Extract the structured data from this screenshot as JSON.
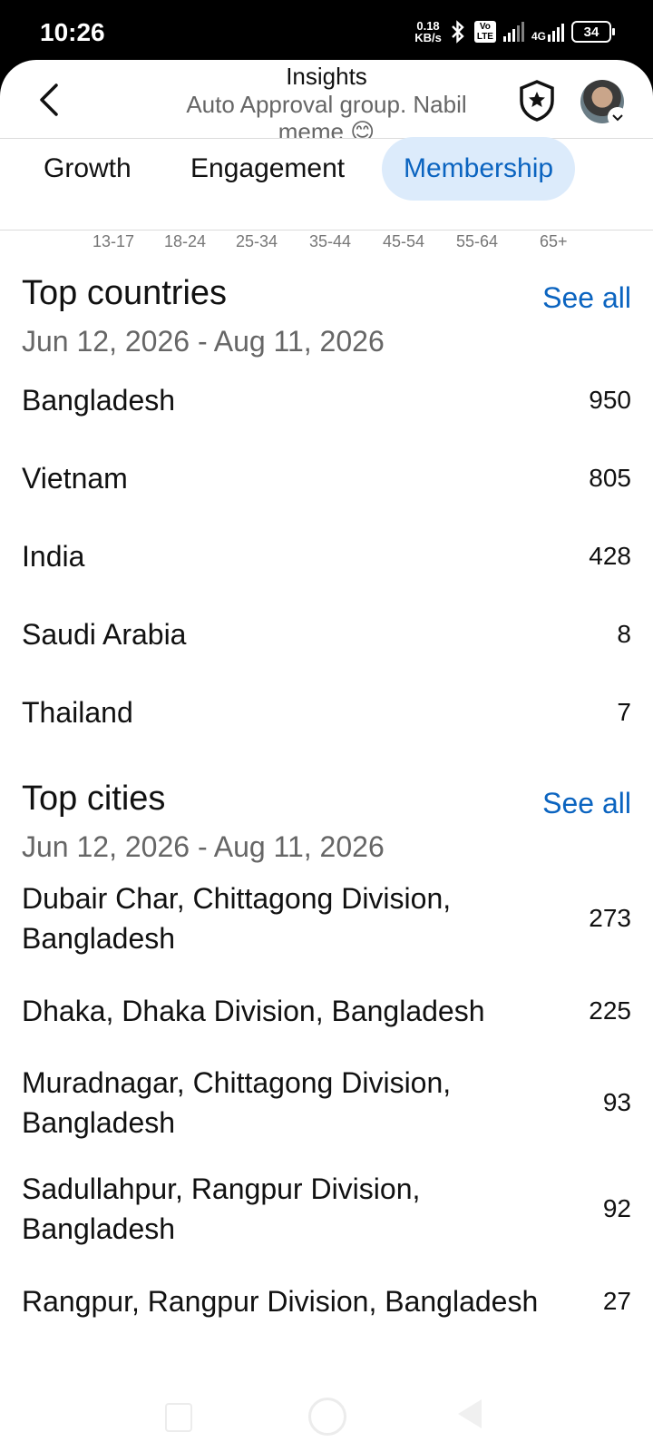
{
  "status_bar": {
    "time": "10:26",
    "net_speed_value": "0.18",
    "net_speed_unit": "KB/s",
    "volte_top": "Vo",
    "volte_bottom": "LTE",
    "network_type": "4G",
    "battery": "34"
  },
  "header": {
    "title": "Insights",
    "subtitle": "Auto Approval group. Nabil",
    "subtitle_cut": "meme 😊"
  },
  "tabs": [
    {
      "label": "Growth",
      "active": false
    },
    {
      "label": "Engagement",
      "active": false
    },
    {
      "label": "Membership",
      "active": true
    }
  ],
  "age_ranges": [
    "13-17",
    "18-24",
    "25-34",
    "35-44",
    "45-54",
    "55-64",
    "65+"
  ],
  "top_countries": {
    "title": "Top countries",
    "see_all": "See all",
    "date_range": "Jun 12, 2026 - Aug 11, 2026",
    "rows": [
      {
        "label": "Bangladesh",
        "value": "950"
      },
      {
        "label": "Vietnam",
        "value": "805"
      },
      {
        "label": "India",
        "value": "428"
      },
      {
        "label": "Saudi Arabia",
        "value": "8"
      },
      {
        "label": "Thailand",
        "value": "7"
      }
    ]
  },
  "top_cities": {
    "title": "Top cities",
    "see_all": "See all",
    "date_range": "Jun 12, 2026 - Aug 11, 2026",
    "rows": [
      {
        "label": "Dubair Char, Chittagong Division, Bangladesh",
        "value": "273"
      },
      {
        "label": "Dhaka, Dhaka Division, Bangladesh",
        "value": "225"
      },
      {
        "label": "Muradnagar, Chittagong Division, Bangladesh",
        "value": "93"
      },
      {
        "label": "Sadullahpur, Rangpur Division, Bangladesh",
        "value": "92"
      },
      {
        "label": "Rangpur, Rangpur Division, Bangladesh",
        "value": "27"
      }
    ]
  },
  "colors": {
    "accent": "#0b64c0",
    "active_tab_bg": "#dcebfb"
  }
}
